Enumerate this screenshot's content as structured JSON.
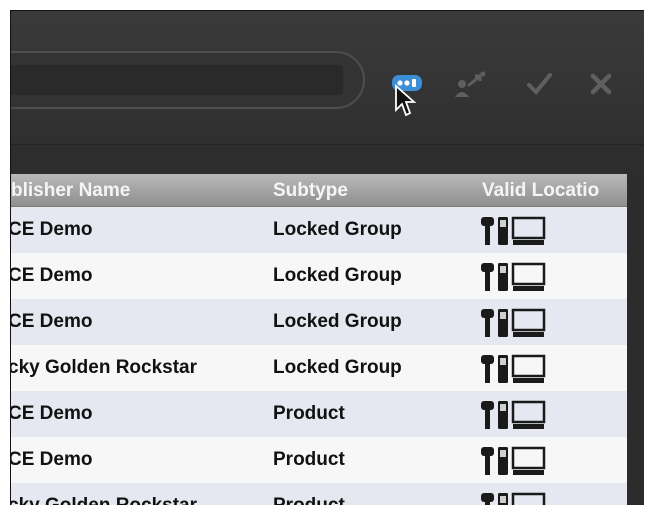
{
  "toolbar": {
    "search": {
      "placeholder": ""
    },
    "buttons": [
      {
        "name": "locations",
        "icon": "location-dots-icon",
        "active": true,
        "color": "#3b8fd6"
      },
      {
        "name": "assign",
        "icon": "users-arrow-icon",
        "active": false
      },
      {
        "name": "approve",
        "icon": "checkmark-icon",
        "active": false
      },
      {
        "name": "reject",
        "icon": "x-icon",
        "active": false
      }
    ]
  },
  "table": {
    "columns": [
      "Publisher Name",
      "Subtype",
      "Valid Locations"
    ],
    "header_visible": [
      "blisher Name",
      "Subtype",
      "Valid Locatio"
    ],
    "rows": [
      {
        "publisher": "CE Demo",
        "subtype": "Locked Group",
        "icons": [
          "microphone-icon",
          "handheld-icon",
          "computer-icon"
        ]
      },
      {
        "publisher": "CE Demo",
        "subtype": "Locked Group",
        "icons": [
          "microphone-icon",
          "handheld-icon",
          "computer-icon"
        ]
      },
      {
        "publisher": "CE Demo",
        "subtype": "Locked Group",
        "icons": [
          "microphone-icon",
          "handheld-icon",
          "computer-icon"
        ]
      },
      {
        "publisher": "cky Golden Rockstar",
        "subtype": "Locked Group",
        "icons": [
          "microphone-icon",
          "handheld-icon",
          "computer-icon"
        ]
      },
      {
        "publisher": "CE Demo",
        "subtype": "Product",
        "icons": [
          "microphone-icon",
          "handheld-icon",
          "computer-icon"
        ]
      },
      {
        "publisher": "CE Demo",
        "subtype": "Product",
        "icons": [
          "microphone-icon",
          "handheld-icon",
          "computer-icon"
        ]
      },
      {
        "publisher": "cky Golden Rockstar",
        "subtype": "Product",
        "icons": [
          "microphone-icon",
          "handheld-icon",
          "computer-icon"
        ]
      }
    ]
  },
  "colors": {
    "toolbar_bg": "#343434",
    "header_bg": "#a3a3a3",
    "row_alt": "#e5e8f0",
    "row": "#f7f7f7",
    "accent": "#3b8fd6",
    "icon_dim": "#6a6a6a"
  }
}
